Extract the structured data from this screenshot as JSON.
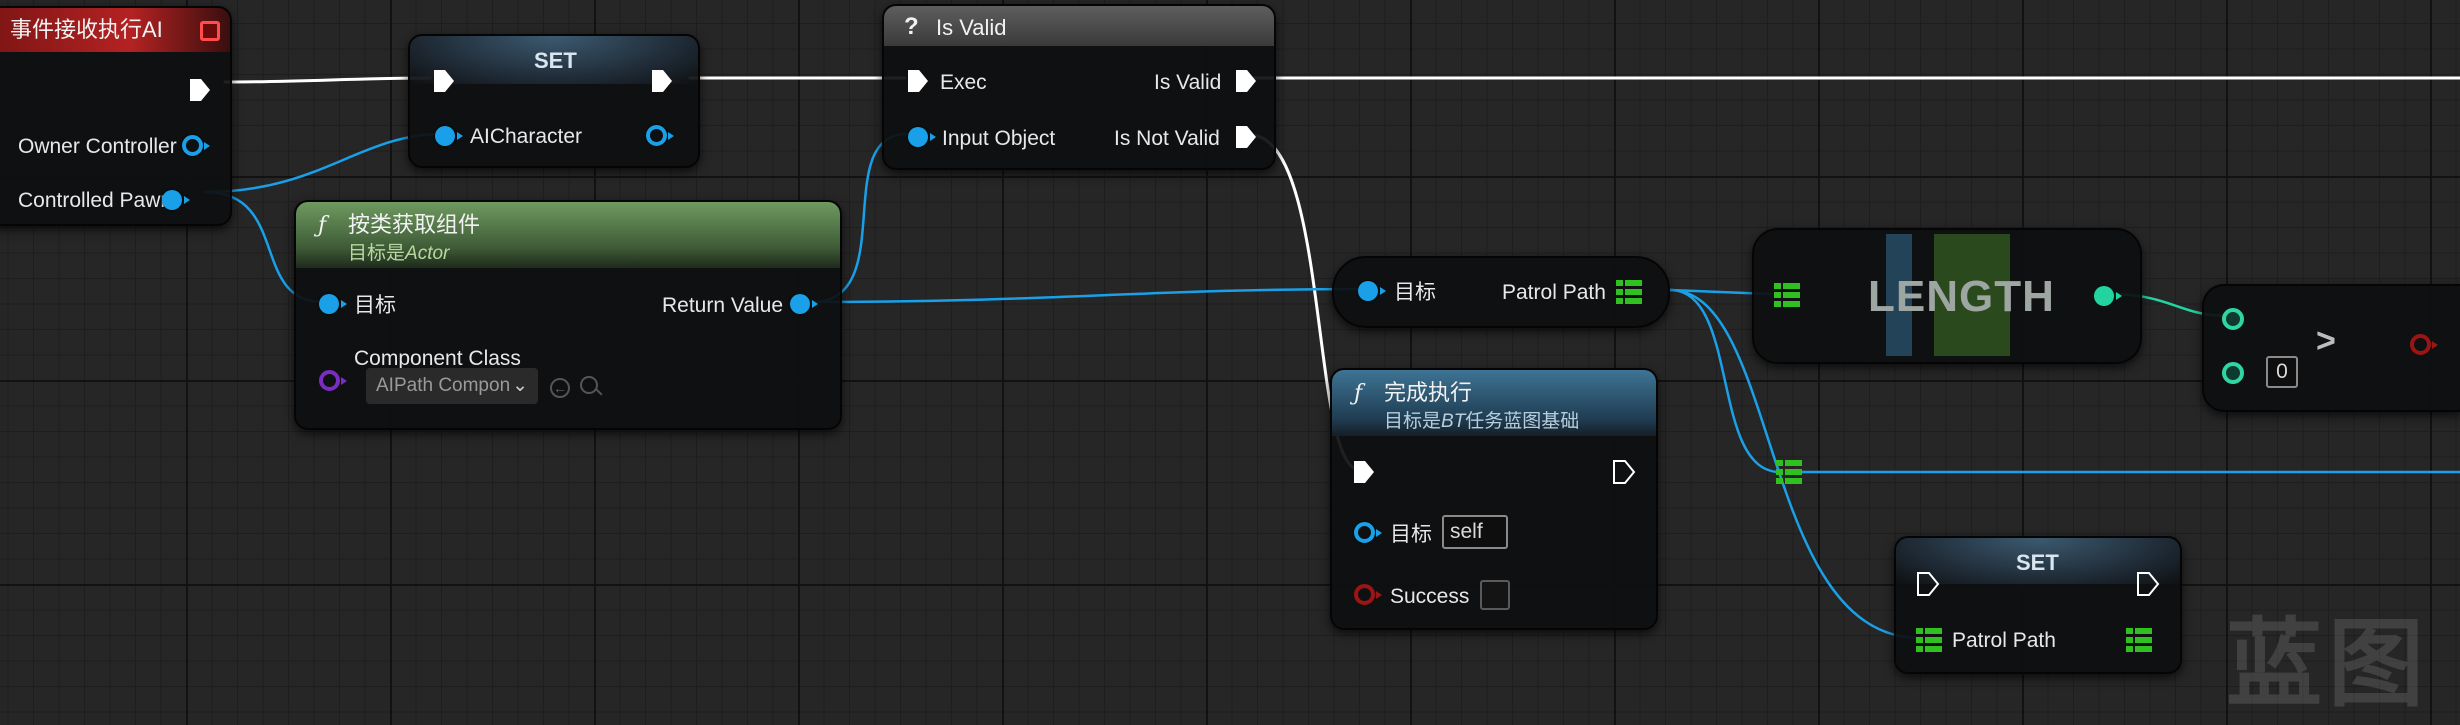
{
  "nodes": {
    "event": {
      "title": "事件接收执行AI",
      "owner_controller": "Owner Controller",
      "controlled_pawn": "Controlled Pawn"
    },
    "set_top": {
      "title": "SET",
      "var": "AICharacter"
    },
    "is_valid": {
      "title": "Is Valid",
      "exec": "Exec",
      "input_object": "Input Object",
      "is_valid": "Is Valid",
      "is_not_valid": "Is Not Valid"
    },
    "get_component": {
      "title": "按类获取组件",
      "subtitle_prefix": "目标是",
      "subtitle_target": "Actor",
      "target": "目标",
      "return_value": "Return Value",
      "component_class": "Component Class",
      "class_value": "AIPath Compon"
    },
    "patrol_getter": {
      "target": "目标",
      "patrol_path": "Patrol Path"
    },
    "length": {
      "title": "LENGTH"
    },
    "compare": {
      "symbol": ">",
      "value": "0"
    },
    "finish": {
      "title": "完成执行",
      "subtitle_prefix": "目标是",
      "subtitle_target": "BT",
      "subtitle_suffix": "任务蓝图基础",
      "target": "目标",
      "target_value": "self",
      "success": "Success"
    },
    "set_bottom": {
      "title": "SET",
      "var": "Patrol Path"
    }
  },
  "watermark": "蓝图",
  "colors": {
    "exec": "#ffffff",
    "object_pin": "#19a0e8",
    "class_pin": "#7a2cc4",
    "bool_pin": "#9a1515",
    "int_pin": "#21d4a0",
    "array_pin": "#30c020",
    "event_header": "#8e1a1a",
    "function_header": "#5c8a50",
    "latent_header": "#2e5c7e"
  },
  "icons": [
    "close-icon",
    "exec-pin-icon",
    "object-pin-icon",
    "array-pin-icon",
    "function-icon",
    "question-icon",
    "chevron-down-icon",
    "arrow-left-icon",
    "search-icon"
  ]
}
